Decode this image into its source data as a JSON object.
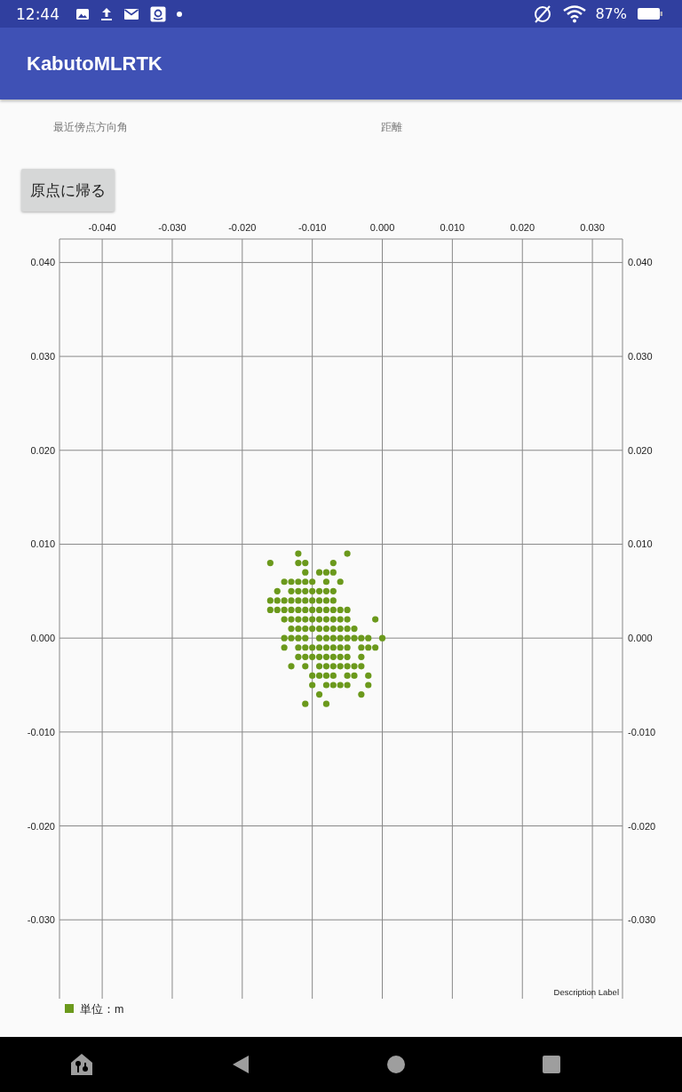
{
  "status_bar": {
    "time": "12:44",
    "battery": "87%"
  },
  "app_bar": {
    "title": "KabutoMLRTK"
  },
  "info_labels": [
    "最近傍点方向角",
    "距離"
  ],
  "home_button": {
    "label": "原点に帰る"
  },
  "chart": {
    "description": "Description Label",
    "chart_data": {
      "type": "scatter",
      "grid": true,
      "xlim": [
        -0.0461,
        0.0343
      ],
      "ylim": [
        -0.0384,
        0.0425
      ],
      "xticks": [
        {
          "value": -0.04,
          "label": "-0.040"
        },
        {
          "value": -0.03,
          "label": "-0.030"
        },
        {
          "value": -0.02,
          "label": "-0.020"
        },
        {
          "value": -0.01,
          "label": "-0.010"
        },
        {
          "value": 0,
          "label": "0.000"
        },
        {
          "value": 0.01,
          "label": "0.010"
        },
        {
          "value": 0.02,
          "label": "0.020"
        },
        {
          "value": 0.03,
          "label": "0.030"
        }
      ],
      "yticks": [
        {
          "value": 0.04,
          "label": "0.040"
        },
        {
          "value": 0.03,
          "label": "0.030"
        },
        {
          "value": 0.02,
          "label": "0.020"
        },
        {
          "value": 0.01,
          "label": "0.010"
        },
        {
          "value": 0,
          "label": "0.000"
        },
        {
          "value": -0.01,
          "label": "-0.010"
        },
        {
          "value": -0.02,
          "label": "-0.020"
        },
        {
          "value": -0.03,
          "label": "-0.030"
        }
      ],
      "x": [
        -0.012,
        -0.005,
        -0.016,
        -0.012,
        -0.011,
        -0.007,
        -0.011,
        -0.009,
        -0.008,
        -0.007,
        -0.014,
        -0.013,
        -0.012,
        -0.011,
        -0.01,
        -0.008,
        -0.006,
        -0.015,
        -0.013,
        -0.012,
        -0.011,
        -0.01,
        -0.009,
        -0.008,
        -0.007,
        -0.016,
        -0.015,
        -0.014,
        -0.013,
        -0.012,
        -0.011,
        -0.01,
        -0.009,
        -0.008,
        -0.007,
        -0.016,
        -0.015,
        -0.014,
        -0.013,
        -0.012,
        -0.011,
        -0.01,
        -0.009,
        -0.008,
        -0.007,
        -0.006,
        -0.005,
        -0.014,
        -0.013,
        -0.012,
        -0.011,
        -0.01,
        -0.009,
        -0.008,
        -0.007,
        -0.006,
        -0.005,
        -0.001,
        -0.013,
        -0.012,
        -0.011,
        -0.01,
        -0.009,
        -0.008,
        -0.007,
        -0.006,
        -0.005,
        -0.004,
        -0.014,
        -0.013,
        -0.012,
        -0.011,
        -0.009,
        -0.008,
        -0.007,
        -0.006,
        -0.005,
        -0.004,
        -0.003,
        -0.002,
        0,
        -0.014,
        -0.012,
        -0.011,
        -0.01,
        -0.009,
        -0.008,
        -0.007,
        -0.006,
        -0.005,
        -0.003,
        -0.002,
        -0.001,
        -0.012,
        -0.011,
        -0.01,
        -0.009,
        -0.008,
        -0.007,
        -0.006,
        -0.005,
        -0.003,
        -0.013,
        -0.011,
        -0.009,
        -0.008,
        -0.007,
        -0.006,
        -0.005,
        -0.004,
        -0.003,
        -0.01,
        -0.009,
        -0.008,
        -0.007,
        -0.005,
        -0.004,
        -0.002,
        -0.01,
        -0.008,
        -0.007,
        -0.006,
        -0.005,
        -0.002,
        -0.009,
        -0.003,
        -0.011,
        -0.008
      ],
      "series": [
        {
          "name": "単位：m",
          "color": "#6b991c",
          "values": [
            0.009,
            0.009,
            0.008,
            0.008,
            0.008,
            0.008,
            0.007,
            0.007,
            0.007,
            0.007,
            0.006,
            0.006,
            0.006,
            0.006,
            0.006,
            0.006,
            0.006,
            0.005,
            0.005,
            0.005,
            0.005,
            0.005,
            0.005,
            0.005,
            0.005,
            0.004,
            0.004,
            0.004,
            0.004,
            0.004,
            0.004,
            0.004,
            0.004,
            0.004,
            0.004,
            0.003,
            0.003,
            0.003,
            0.003,
            0.003,
            0.003,
            0.003,
            0.003,
            0.003,
            0.003,
            0.003,
            0.003,
            0.002,
            0.002,
            0.002,
            0.002,
            0.002,
            0.002,
            0.002,
            0.002,
            0.002,
            0.002,
            0.002,
            0.001,
            0.001,
            0.001,
            0.001,
            0.001,
            0.001,
            0.001,
            0.001,
            0.001,
            0.001,
            0,
            0,
            0,
            0,
            0,
            0,
            0,
            0,
            0,
            0,
            0,
            0,
            0,
            -0.001,
            -0.001,
            -0.001,
            -0.001,
            -0.001,
            -0.001,
            -0.001,
            -0.001,
            -0.001,
            -0.001,
            -0.001,
            -0.001,
            -0.002,
            -0.002,
            -0.002,
            -0.002,
            -0.002,
            -0.002,
            -0.002,
            -0.002,
            -0.002,
            -0.003,
            -0.003,
            -0.003,
            -0.003,
            -0.003,
            -0.003,
            -0.003,
            -0.003,
            -0.003,
            -0.004,
            -0.004,
            -0.004,
            -0.004,
            -0.004,
            -0.004,
            -0.004,
            -0.005,
            -0.005,
            -0.005,
            -0.005,
            -0.005,
            -0.005,
            -0.006,
            -0.006,
            -0.007,
            -0.007
          ]
        }
      ]
    }
  }
}
